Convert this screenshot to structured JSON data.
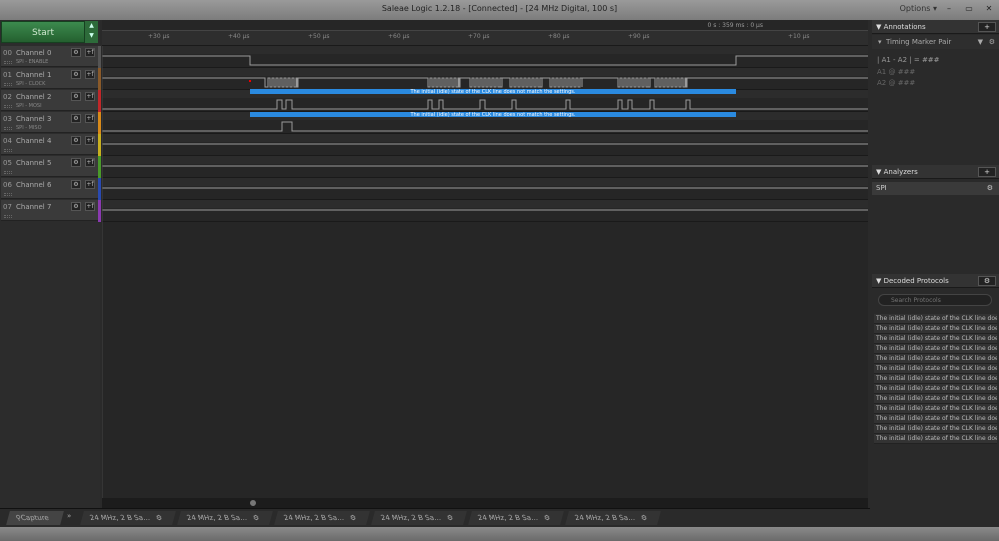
{
  "window": {
    "title": "Saleae Logic 1.2.18 - [Connected] - [24 MHz Digital, 100 s]",
    "options": "Options ▾",
    "minimize": "–",
    "restore": "▭",
    "close": "✕"
  },
  "capture": {
    "start_label": "Start",
    "cursor_time": "0 s : 359 ms : 0 μs"
  },
  "ruler": {
    "ticks": [
      "+30 μs",
      "+40 μs",
      "+50 μs",
      "+60 μs",
      "+70 μs",
      "+80 μs",
      "+90 μs",
      "+10 μs"
    ]
  },
  "channels": [
    {
      "num": "00",
      "name": "Channel 0",
      "sub": "SPI - ENABLE",
      "color": "#555555"
    },
    {
      "num": "01",
      "name": "Channel 1",
      "sub": "SPI - CLOCK",
      "color": "#8a5a2a"
    },
    {
      "num": "02",
      "name": "Channel 2",
      "sub": "SPI - MOSI",
      "color": "#c0282a"
    },
    {
      "num": "03",
      "name": "Channel 3",
      "sub": "SPI - MISO",
      "color": "#d88a1a"
    },
    {
      "num": "04",
      "name": "Channel 4",
      "sub": "",
      "color": "#c8b020"
    },
    {
      "num": "05",
      "name": "Channel 5",
      "sub": "",
      "color": "#4a9a2a"
    },
    {
      "num": "06",
      "name": "Channel 6",
      "sub": "",
      "color": "#2a4ab0"
    },
    {
      "num": "07",
      "name": "Channel 7",
      "sub": "",
      "color": "#8a3ab0"
    }
  ],
  "warning": "The initial (idle) state of the CLK line does not match the settings.",
  "annotations": {
    "title": "Annotations",
    "marker": "Timing Marker Pair",
    "formula": "| A1 - A2 | = ###",
    "a1": "A1  @  ###",
    "a2": "A2  @  ###"
  },
  "analyzers": {
    "title": "Analyzers",
    "items": [
      "SPI"
    ]
  },
  "decoded": {
    "title": "Decoded Protocols",
    "search_placeholder": "Search Protocols",
    "rows": [
      "The initial (idle) state of the CLK line doe...",
      "The initial (idle) state of the CLK line doe...",
      "The initial (idle) state of the CLK line doe...",
      "The initial (idle) state of the CLK line doe...",
      "The initial (idle) state of the CLK line doe...",
      "The initial (idle) state of the CLK line doe...",
      "The initial (idle) state of the CLK line doe...",
      "The initial (idle) state of the CLK line doe...",
      "The initial (idle) state of the CLK line doe...",
      "The initial (idle) state of the CLK line doe...",
      "The initial (idle) state of the CLK line doe...",
      "The initial (idle) state of the CLK line doe...",
      "The initial (idle) state of the CLK line doe..."
    ]
  },
  "tabs": {
    "capture": "Capture",
    "more": "»",
    "sessions": [
      "24 MHz, 2 B Sa...",
      "24 MHz, 2 B Sa...",
      "24 MHz, 2 B Sa...",
      "24 MHz, 2 B Sa...",
      "24 MHz, 2 B Sa...",
      "24 MHz, 2 B Sa..."
    ]
  }
}
